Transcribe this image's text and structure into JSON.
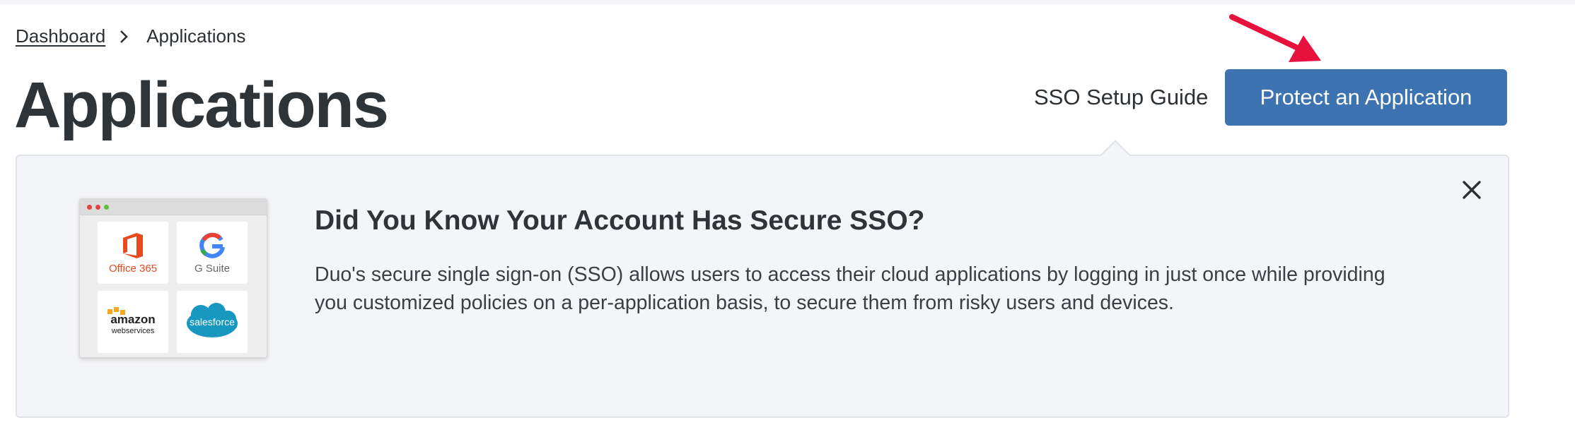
{
  "breadcrumb": {
    "parent": "Dashboard",
    "current": "Applications"
  },
  "page": {
    "title": "Applications"
  },
  "header_actions": {
    "sso_guide": "SSO Setup Guide",
    "protect_button": "Protect an Application"
  },
  "promo": {
    "heading": "Did You Know Your Account Has Secure SSO?",
    "body": "Duo's secure single sign-on (SSO) allows users to access their cloud applications by logging in just once while providing you customized policies on a per-application basis, to secure them from risky users and devices.",
    "tiles": {
      "office": "Office 365",
      "gsuite": "G Suite",
      "amazon_top": "amazon",
      "amazon_bottom": "webservices",
      "salesforce": "salesforce"
    }
  },
  "colors": {
    "accent": "#3c73b0",
    "annotation_arrow": "#e8103c",
    "panel_bg": "#f4f5f8"
  }
}
